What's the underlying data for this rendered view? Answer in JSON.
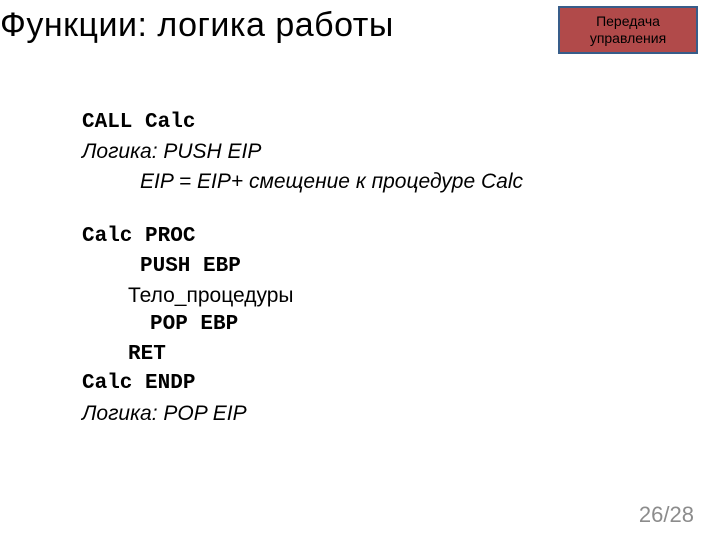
{
  "header": {
    "title": "Функции: логика работы",
    "badge_line1": "Передача",
    "badge_line2": "управления"
  },
  "content": {
    "line1": "CALL Calc",
    "line2a": "Логика: ",
    "line2b": "PUSH EIP",
    "line3": "EIP = EIP+ смещение к процедуре Calc",
    "line4": "Calc PROC",
    "line5": "PUSH EBP",
    "line6": "Тело_процедуры",
    "line7": "POP EBP",
    "line8": "RET",
    "line9": "Calc ENDP",
    "line10a": "Логика: ",
    "line10b": "POP EIP"
  },
  "pager": {
    "current": "26",
    "sep": "/",
    "total": "28"
  }
}
